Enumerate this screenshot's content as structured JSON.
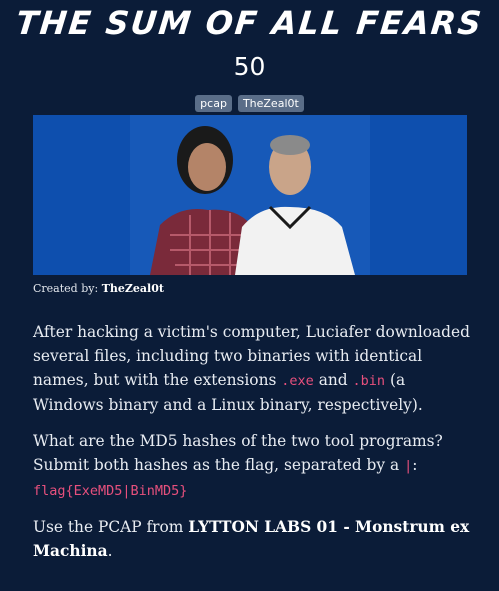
{
  "challenge": {
    "title": "THE SUM OF ALL FEARS",
    "points": "50",
    "tags": [
      "pcap",
      "TheZeal0t"
    ],
    "created_label": "Created by:",
    "author": "TheZeal0t"
  },
  "description": {
    "p1_a": "After hacking a victim's computer, Luciafer downloaded several files, including two binaries with identical names, but with the extensions ",
    "p1_code1": ".exe",
    "p1_b": " and ",
    "p1_code2": ".bin",
    "p1_c": " (a Windows binary and a Linux binary, respectively).",
    "p2_a": "What are the MD5 hashes of the two tool programs? Submit both hashes as the flag, separated by a ",
    "p2_code1": "|",
    "p2_b": ":",
    "p2_code2": "flag{ExeMD5|BinMD5}",
    "p3_a": "Use the PCAP from ",
    "p3_bold": "LYTTON LABS 01 - Monstrum ex Machina",
    "p3_b": "."
  },
  "colors": {
    "background": "#0b1c38",
    "tag": "#5a6d88",
    "code": "#e7507d",
    "photo_bg": "#0e4fae"
  }
}
